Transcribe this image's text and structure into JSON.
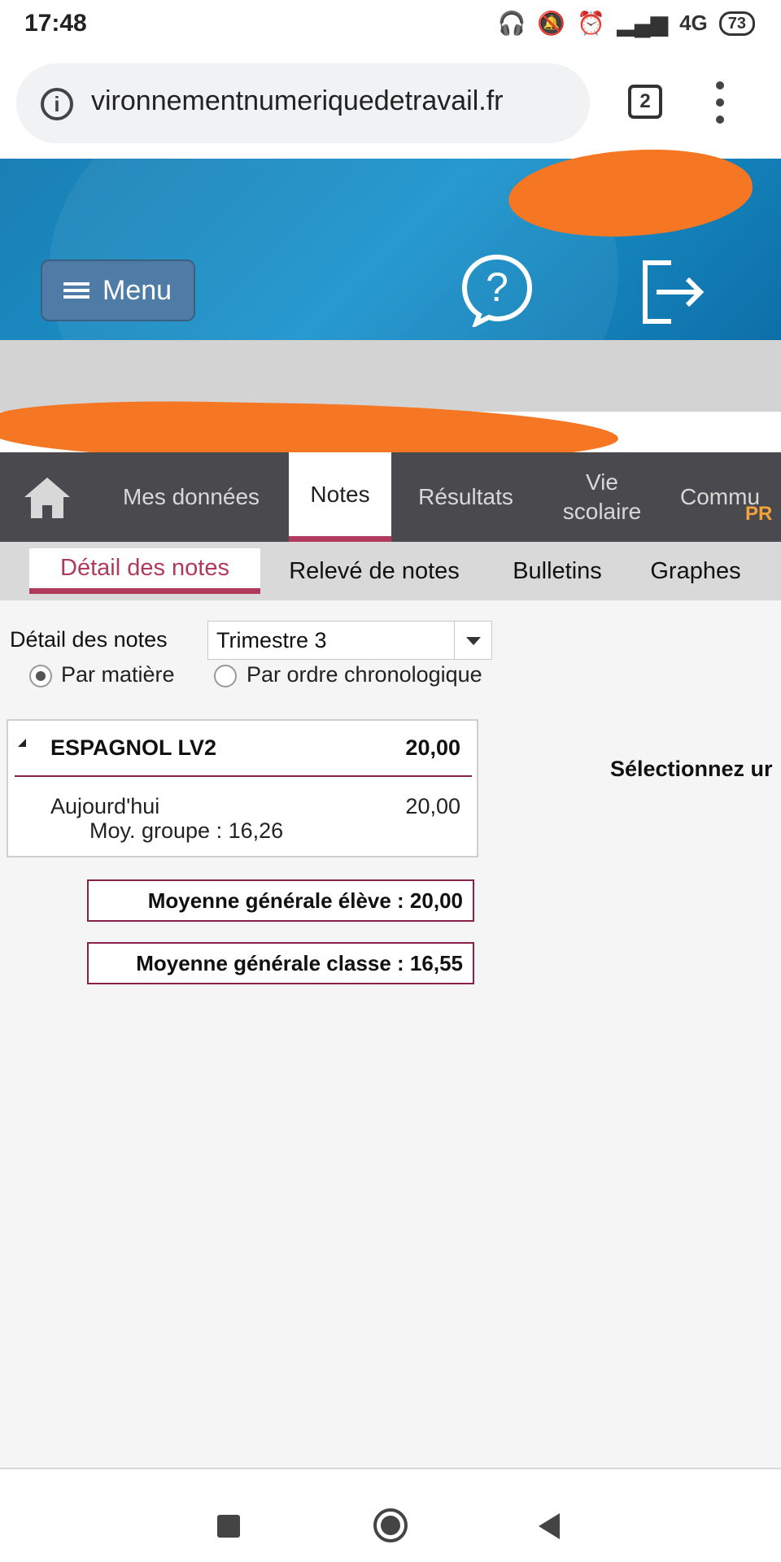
{
  "status_bar": {
    "time": "17:48",
    "network": "4G",
    "battery": "73",
    "icons": [
      "headset-icon",
      "bell-muted-icon",
      "alarm-icon",
      "signal-icon"
    ]
  },
  "browser": {
    "url": "vironnementnumeriquedetravail.fr",
    "tabs_count": "2"
  },
  "header": {
    "menu_label": "Menu"
  },
  "main_nav": {
    "items": [
      {
        "label": "Mes données"
      },
      {
        "label": "Notes"
      },
      {
        "label": "Résultats"
      },
      {
        "label": "Vie scolaire"
      },
      {
        "label": "Commu"
      }
    ],
    "active": "Notes",
    "badge": "PR"
  },
  "sub_nav": {
    "tabs": [
      {
        "label": "Détail des notes"
      },
      {
        "label": "Relevé de notes"
      },
      {
        "label": "Bulletins"
      },
      {
        "label": "Graphes"
      }
    ],
    "active": "Détail des notes"
  },
  "filters": {
    "label": "Détail des notes",
    "period": "Trimestre 3",
    "radio_options": [
      {
        "label": "Par matière",
        "checked": true
      },
      {
        "label": "Par ordre chronologique",
        "checked": false
      }
    ]
  },
  "subject": {
    "name": "ESPAGNOL LV2",
    "average": "20,00",
    "notes": [
      {
        "date": "Aujourd'hui",
        "value": "20,00",
        "group_average": "Moy. groupe : 16,26"
      }
    ]
  },
  "averages": {
    "eleve": "Moyenne générale élève : 20,00",
    "classe": "Moyenne générale classe : 16,55"
  },
  "hint": "Sélectionnez ur",
  "colors": {
    "accent": "#b03a5b",
    "nav_bg": "#4a4a4e",
    "header_blue": "#1a8fc6",
    "redaction": "#f57623"
  }
}
